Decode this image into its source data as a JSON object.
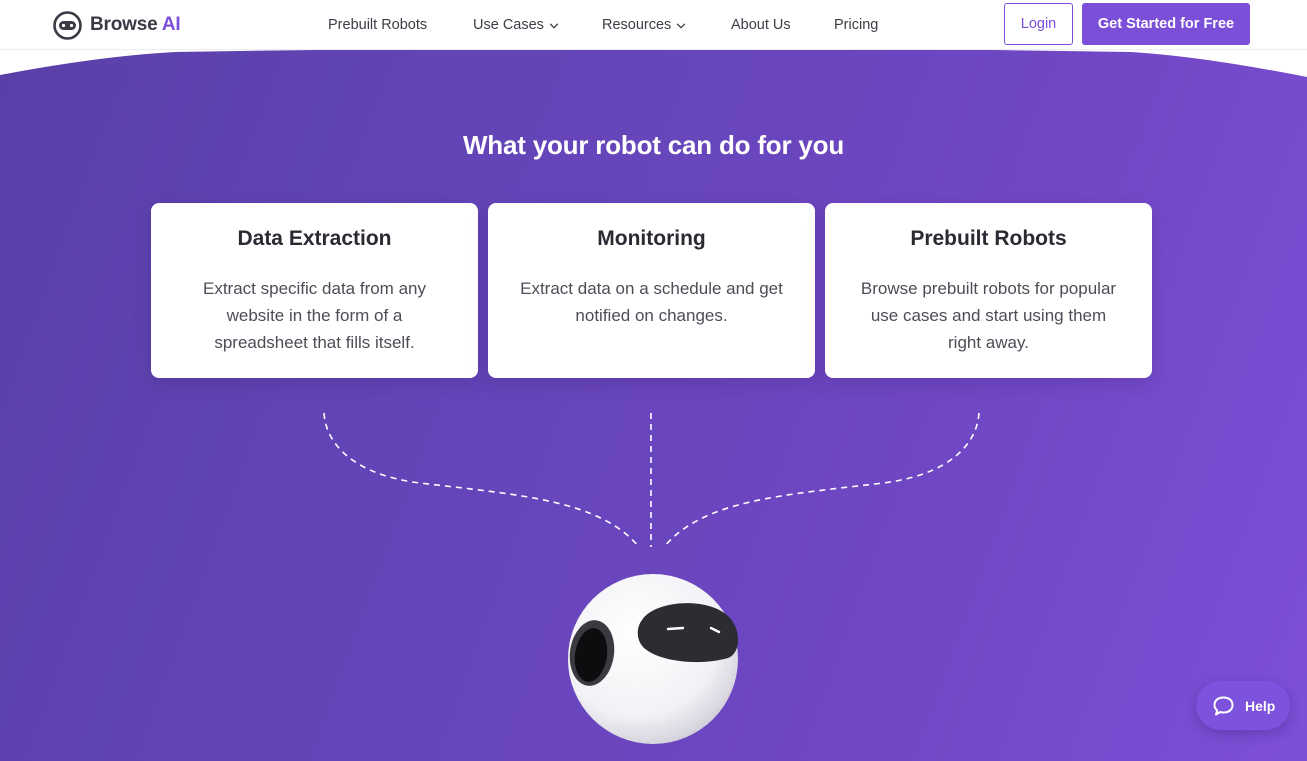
{
  "brand": {
    "name_main": "Browse",
    "name_accent": "AI",
    "logo_icon": "robot-face-icon",
    "accent_color": "#7b4fd8"
  },
  "nav": {
    "items": [
      {
        "label": "Prebuilt Robots",
        "has_dropdown": false
      },
      {
        "label": "Use Cases",
        "has_dropdown": true
      },
      {
        "label": "Resources",
        "has_dropdown": true
      },
      {
        "label": "About Us",
        "has_dropdown": false
      },
      {
        "label": "Pricing",
        "has_dropdown": false
      }
    ],
    "login_label": "Login",
    "cta_label": "Get Started for Free"
  },
  "hero": {
    "title": "What your robot can do for you",
    "gradient_colors": [
      "#5a3fa8",
      "#7d50d8"
    ],
    "cards": [
      {
        "title": "Data Extraction",
        "description": "Extract specific data from any website in the form of a spreadsheet that fills itself."
      },
      {
        "title": "Monitoring",
        "description": "Extract data on a schedule and get notified on changes."
      },
      {
        "title": "Prebuilt Robots",
        "description": "Browse prebuilt robots for popular use cases and start using them right away."
      }
    ]
  },
  "help": {
    "label": "Help",
    "icon": "chat-bubble-icon"
  }
}
